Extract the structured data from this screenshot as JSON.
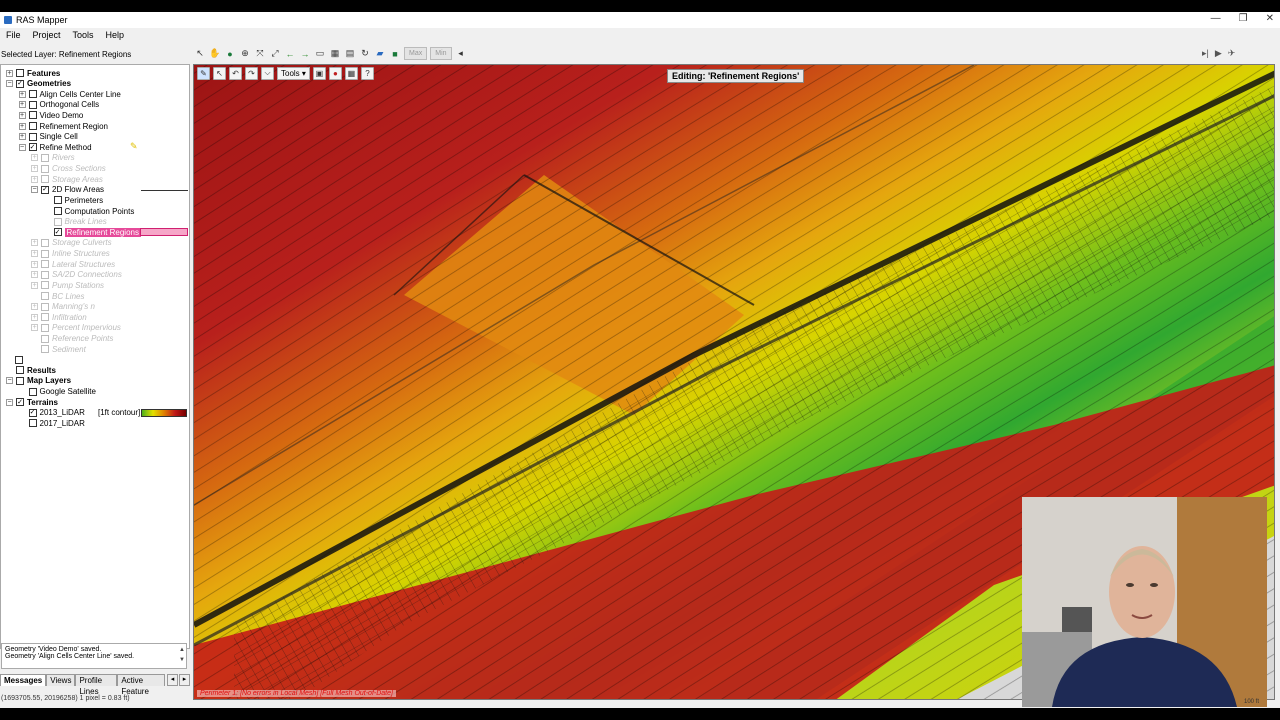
{
  "window": {
    "title": "RAS Mapper",
    "controls": [
      "—",
      "❐",
      "✕"
    ]
  },
  "menu": [
    "File",
    "Project",
    "Tools",
    "Help"
  ],
  "selected_layer": "Selected Layer: Refinement Regions",
  "map_toolbar": {
    "max_label": "Max",
    "min_label": "Min"
  },
  "edit_toolbar": {
    "tools_label": "Tools",
    "help_label": "?"
  },
  "editing_label": "Editing: 'Refinement Regions'",
  "tree": [
    {
      "label": "Features",
      "level": 0,
      "expander": "+",
      "checked": false,
      "bold": true
    },
    {
      "label": "Geometries",
      "level": 0,
      "expander": "−",
      "checked": true,
      "bold": true
    },
    {
      "label": "Align Cells Center Line",
      "level": 1,
      "expander": "+",
      "checked": false
    },
    {
      "label": "Orthogonal Cells",
      "level": 1,
      "expander": "+",
      "checked": false
    },
    {
      "label": "Video Demo",
      "level": 1,
      "expander": "+",
      "checked": false
    },
    {
      "label": "Refinement Region",
      "level": 1,
      "expander": "+",
      "checked": false
    },
    {
      "label": "Single Cell",
      "level": 1,
      "expander": "+",
      "checked": false
    },
    {
      "label": "Refine Method",
      "level": 1,
      "expander": "−",
      "checked": true
    },
    {
      "label": "Rivers",
      "level": 2,
      "expander": "+",
      "checked": false,
      "dim": true
    },
    {
      "label": "Cross Sections",
      "level": 2,
      "expander": "+",
      "checked": false,
      "dim": true
    },
    {
      "label": "Storage Areas",
      "level": 2,
      "expander": "+",
      "checked": false,
      "dim": true
    },
    {
      "label": "2D Flow Areas",
      "level": 2,
      "expander": "−",
      "checked": true
    },
    {
      "label": "Perimeters",
      "level": 3,
      "checked": false
    },
    {
      "label": "Computation Points",
      "level": 3,
      "checked": false
    },
    {
      "label": "Break Lines",
      "level": 3,
      "checked": false,
      "dim": true
    },
    {
      "label": "Refinement Regions",
      "level": 3,
      "checked": true,
      "highlight": true
    },
    {
      "label": "Storage Culverts",
      "level": 2,
      "expander": "+",
      "checked": false,
      "dim": true
    },
    {
      "label": "Inline Structures",
      "level": 2,
      "expander": "+",
      "checked": false,
      "dim": true
    },
    {
      "label": "Lateral Structures",
      "level": 2,
      "expander": "+",
      "checked": false,
      "dim": true
    },
    {
      "label": "SA/2D Connections",
      "level": 2,
      "expander": "+",
      "checked": false,
      "dim": true
    },
    {
      "label": "Pump Stations",
      "level": 2,
      "expander": "+",
      "checked": false,
      "dim": true
    },
    {
      "label": "BC Lines",
      "level": 2,
      "checked": false,
      "dim": true
    },
    {
      "label": "Manning's n",
      "level": 2,
      "expander": "+",
      "checked": false,
      "dim": true
    },
    {
      "label": "Infiltration",
      "level": 2,
      "expander": "+",
      "checked": false,
      "dim": true
    },
    {
      "label": "Percent Impervious",
      "level": 2,
      "expander": "+",
      "checked": false,
      "dim": true
    },
    {
      "label": "Reference Points",
      "level": 2,
      "checked": false,
      "dim": true
    },
    {
      "label": "Sediment",
      "level": 2,
      "checked": false,
      "dim": true
    },
    {
      "label": "",
      "level": 0,
      "checked": false,
      "spacer": true
    },
    {
      "label": "Results",
      "level": 0,
      "checked": false,
      "bold": true
    },
    {
      "label": "Map Layers",
      "level": 0,
      "expander": "−",
      "checked": false,
      "bold": true
    },
    {
      "label": "Google Satellite",
      "level": 1,
      "checked": false
    },
    {
      "label": "Terrains",
      "level": 0,
      "expander": "−",
      "checked": true,
      "bold": true
    },
    {
      "label": "2013_LiDAR",
      "level": 1,
      "checked": true,
      "note": "[1ft contour]"
    },
    {
      "label": "2017_LiDAR",
      "level": 1,
      "checked": false
    }
  ],
  "messages": [
    "Geometry 'Video Demo' saved.",
    "Geometry 'Align Cells Center Line' saved."
  ],
  "bottom_tabs": [
    "Messages",
    "Views",
    "Profile Lines",
    "Active Feature"
  ],
  "coords": "(1693705.55, 20196258)  1 pixel = 0.83 ft)",
  "map_status": "Perimeter 1: [No errors in Local Mesh]  [Full Mesh Out-of-Date]",
  "scale_text": "100 ft",
  "colors": {
    "accent_pink": "#e64a9a",
    "terrain_high": "#b01a1a",
    "terrain_mid": "#e4e000",
    "terrain_low": "#2fa52f"
  },
  "icons": [
    "pointer-icon",
    "pan-icon",
    "globe-icon",
    "zoom-in-icon",
    "zoom-extent-icon",
    "zoom-full-icon",
    "back-arrow-icon",
    "forward-arrow-icon",
    "measure-icon",
    "grid-icon",
    "layers-icon",
    "refresh-icon",
    "map-icon",
    "save-icon"
  ]
}
